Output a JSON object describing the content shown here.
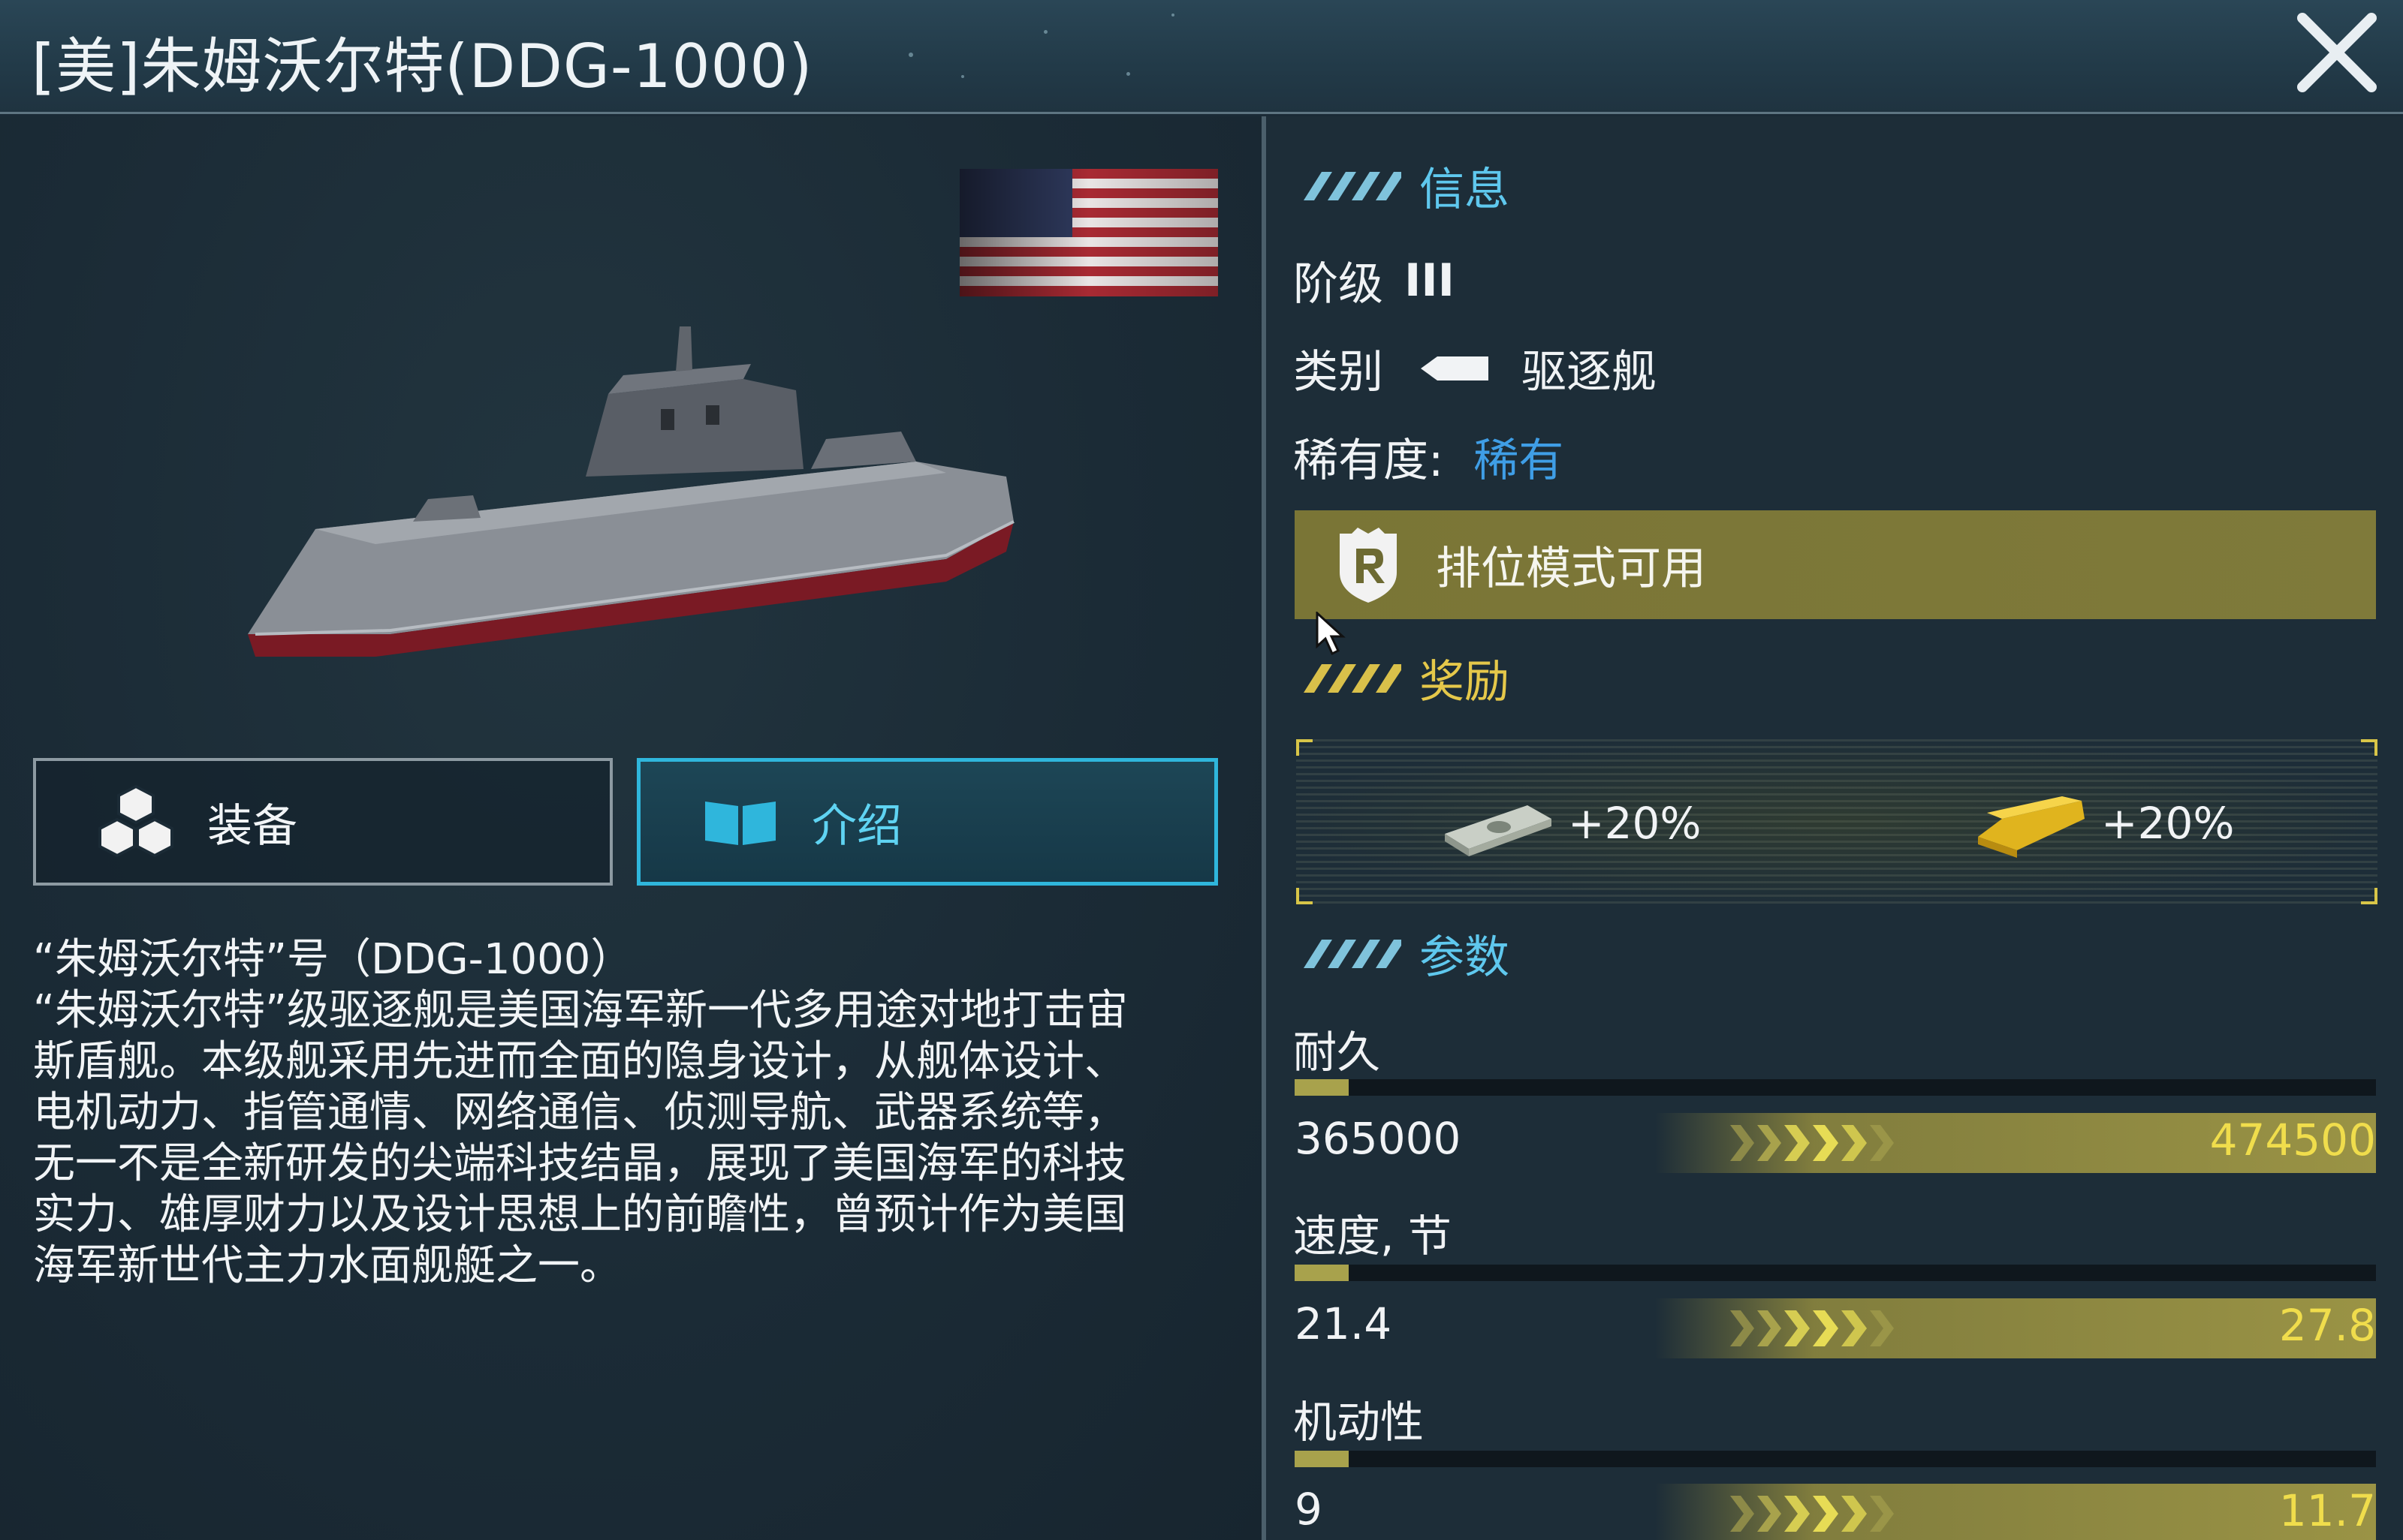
{
  "header": {
    "title": "[美]朱姆沃尔特(DDG-1000)",
    "close_icon": "close-x-icon"
  },
  "tabs": {
    "equipment": {
      "label": "装备",
      "icon": "equipment-cubes-icon"
    },
    "intro": {
      "label": "介绍",
      "icon": "open-book-icon",
      "active": true
    }
  },
  "description": {
    "line1": "“朱姆沃尔特”号（DDG-1000）",
    "line2": "“朱姆沃尔特”级驱逐舰是美国海军新一代多用途对地打击宙",
    "line3": "斯盾舰。本级舰采用先进而全面的隐身设计，从舰体设计、",
    "line4": "电机动力、指管通情、网络通信、侦测导航、武器系统等，",
    "line5": "无一不是全新研发的尖端科技结晶，展现了美国海军的科技",
    "line6": "实力、雄厚财力以及设计思想上的前瞻性，曾预计作为美国",
    "line7": "海军新世代主力水面舰艇之一。"
  },
  "info": {
    "section_title": "信息",
    "tier_label": "阶级",
    "tier_value": "III",
    "class_label": "类别",
    "class_value": "驱逐舰",
    "rarity_label": "稀有度:",
    "rarity_value": "稀有",
    "ranked_text": "排位模式可用"
  },
  "rewards": {
    "section_title": "奖励",
    "items": [
      {
        "icon": "cash-stack-icon",
        "value": "+20%"
      },
      {
        "icon": "gold-bar-icon",
        "value": "+20%"
      }
    ]
  },
  "params": {
    "section_title": "参数",
    "items": [
      {
        "label": "耐久",
        "current": "365000",
        "max": "474500",
        "fill": 0.05
      },
      {
        "label": "速度, 节",
        "current": "21.4",
        "max": "27.8",
        "fill": 0.05
      },
      {
        "label": "机动性",
        "current": "9",
        "max": "11.7",
        "fill": 0.05
      }
    ]
  },
  "colors": {
    "accent_blue": "#5fc8ee",
    "accent_yellow": "#e5c84a",
    "rarity_blue": "#3f9ee6",
    "ranked_banner": "#7f7a3a"
  }
}
